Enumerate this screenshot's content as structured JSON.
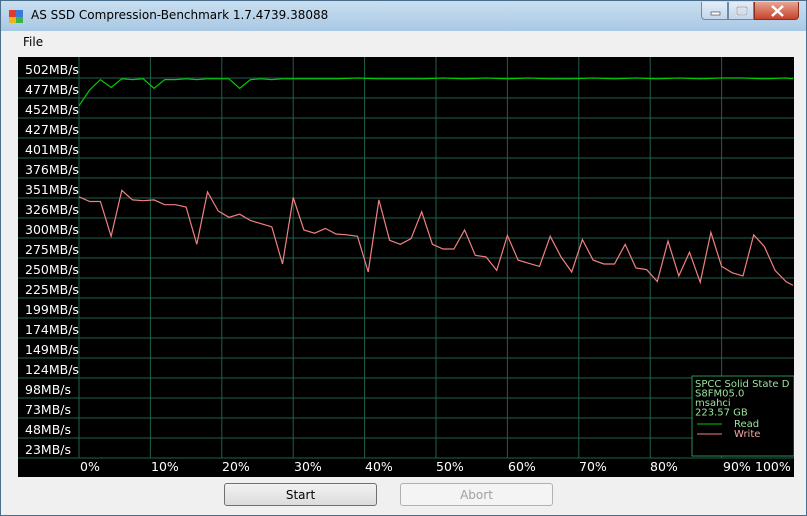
{
  "window": {
    "title": "AS SSD Compression-Benchmark 1.7.4739.38088"
  },
  "menu": {
    "file": "File"
  },
  "buttons": {
    "start": "Start",
    "abort": "Abort"
  },
  "colors": {
    "read": "#00cc00",
    "write": "#f08080",
    "grid": "#1f5f4f",
    "plot_bg": "#000000",
    "label": "#ffffff"
  },
  "chart_data": {
    "type": "line",
    "title": "",
    "xlabel": "",
    "ylabel": "",
    "xlim": [
      0,
      100
    ],
    "ylim": [
      10,
      514
    ],
    "y_ticks": [
      "23MB/s",
      "48MB/s",
      "73MB/s",
      "98MB/s",
      "124MB/s",
      "149MB/s",
      "174MB/s",
      "199MB/s",
      "225MB/s",
      "250MB/s",
      "275MB/s",
      "300MB/s",
      "326MB/s",
      "351MB/s",
      "376MB/s",
      "401MB/s",
      "427MB/s",
      "452MB/s",
      "477MB/s",
      "502MB/s"
    ],
    "x_ticks": [
      "0%",
      "10%",
      "20%",
      "30%",
      "40%",
      "50%",
      "60%",
      "70%",
      "80%",
      "90%",
      "100%"
    ],
    "grid": true,
    "legend": {
      "position": "bottom-right",
      "device": [
        "SPCC Solid State D",
        "S8FM05.0",
        "msahci",
        "223.57 GB"
      ]
    },
    "series": [
      {
        "name": "Read",
        "x": [
          0,
          1.5,
          3,
          4.5,
          6,
          7.5,
          9,
          10.5,
          12,
          13.5,
          15,
          16.5,
          18,
          19.5,
          21,
          22.5,
          24,
          25.5,
          27,
          28.5,
          30,
          33,
          36,
          39,
          42,
          45,
          48,
          51,
          54,
          57,
          60,
          63,
          66,
          69,
          72,
          75,
          78,
          81,
          84,
          87,
          90,
          93,
          96,
          99,
          100
        ],
        "y": [
          455,
          475,
          488,
          478,
          489,
          488,
          489,
          477,
          488,
          488,
          489,
          488,
          489,
          489,
          489,
          477,
          488,
          489,
          488,
          489,
          489,
          489,
          489,
          490,
          489,
          489,
          489,
          490,
          489,
          490,
          489,
          490,
          489,
          489,
          490,
          489,
          490,
          489,
          490,
          489,
          490,
          490,
          489,
          490,
          489
        ]
      },
      {
        "name": "Write",
        "x": [
          0,
          1.5,
          3,
          4.5,
          6,
          7.5,
          9,
          10.5,
          12,
          13.5,
          15,
          16.5,
          18,
          19.5,
          21,
          22.5,
          24,
          25.5,
          27,
          28.5,
          30,
          31.5,
          33,
          34.5,
          36,
          37.5,
          39,
          40.5,
          42,
          43.5,
          45,
          46.5,
          48,
          49.5,
          51,
          52.5,
          54,
          55.5,
          57,
          58.5,
          60,
          61.5,
          63,
          64.5,
          66,
          67.5,
          69,
          70.5,
          72,
          73.5,
          75,
          76.5,
          78,
          79.5,
          81,
          82.5,
          84,
          85.5,
          87,
          88.5,
          90,
          91.5,
          93,
          94.5,
          96,
          97.5,
          99,
          100
        ],
        "y": [
          340,
          334,
          334,
          290,
          348,
          336,
          335,
          336,
          330,
          330,
          327,
          280,
          346,
          322,
          314,
          318,
          310,
          306,
          302,
          255,
          339,
          298,
          294,
          300,
          293,
          292,
          290,
          245,
          336,
          285,
          280,
          287,
          321,
          280,
          274,
          274,
          298,
          266,
          264,
          247,
          291,
          260,
          256,
          252,
          290,
          264,
          245,
          286,
          260,
          255,
          255,
          280,
          250,
          248,
          233,
          284,
          240,
          270,
          232,
          295,
          252,
          244,
          240,
          292,
          277,
          247,
          233,
          228
        ]
      }
    ]
  }
}
